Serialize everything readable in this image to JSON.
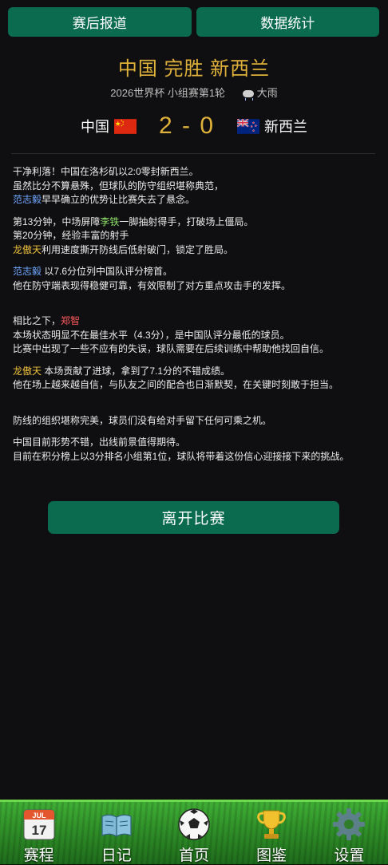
{
  "tabs": {
    "report": "赛后报道",
    "stats": "数据统计"
  },
  "match": {
    "headline": "中国 完胜 新西兰",
    "competition": "2026世界杯  小组赛第1轮",
    "weather": "大雨",
    "home": "中国",
    "away": "新西兰",
    "score": "2 - 0"
  },
  "report": {
    "p1a": "干净利落！中国在洛杉矶以2:0零封新西兰。",
    "p1b": "虽然比分不算悬殊，但球队的防守组织堪称典范，",
    "p1c_name": "范志毅",
    "p1c": "早早确立的优势让比赛失去了悬念。",
    "p2a_pre": "第13分钟，中场屏障",
    "p2a_name": "李铁",
    "p2a_post": "一脚抽射得手，打破场上僵局。",
    "p2b": "第20分钟，经验丰富的射手",
    "p2c_name": "龙傲天",
    "p2c": "利用速度撕开防线后低射破门，锁定了胜局。",
    "p3a_name": "范志毅",
    "p3a": " 以7.6分位列中国队评分榜首。",
    "p3b": "他在防守端表现得稳健可靠，有效限制了对方重点攻击手的发挥。",
    "p4a_pre": "相比之下，",
    "p4a_name": "郑智",
    "p4b": "本场状态明显不在最佳水平（4.3分），是中国队评分最低的球员。",
    "p4c": "比赛中出现了一些不应有的失误，球队需要在后续训练中帮助他找回自信。",
    "p5a_name": "龙傲天",
    "p5a": " 本场贡献了进球，拿到了7.1分的不错成绩。",
    "p5b": "他在场上越来越自信，与队友之间的配合也日渐默契，在关键时刻敢于担当。",
    "p6": "防线的组织堪称完美，球员们没有给对手留下任何可乘之机。",
    "p7a": "中国目前形势不错，出线前景值得期待。",
    "p7b": "目前在积分榜上以3分排名小组第1位，球队将带着这份信心迎接接下来的挑战。"
  },
  "leave_button": "离开比赛",
  "nav": {
    "calendar_month": "JUL",
    "calendar_day": "17",
    "schedule": "赛程",
    "diary": "日记",
    "home": "首页",
    "gallery": "图鉴",
    "settings": "设置"
  }
}
